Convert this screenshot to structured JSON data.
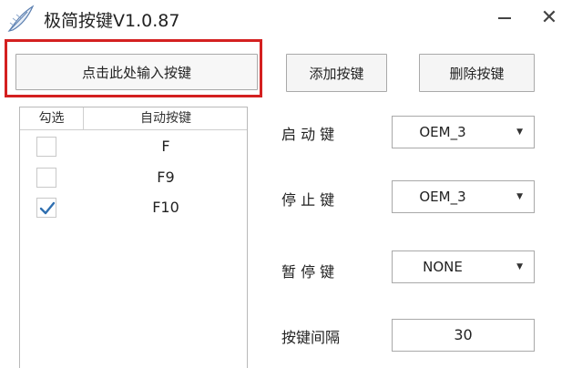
{
  "window": {
    "title": "极简按键V1.0.87",
    "minimize_icon": "minimize-icon",
    "close_glyph": "✕"
  },
  "toolbar": {
    "input_key_label": "点击此处输入按键",
    "add_label": "添加按键",
    "delete_label": "删除按键"
  },
  "key_list": {
    "columns": [
      "勾选",
      "自动按键"
    ],
    "rows": [
      {
        "key": "F",
        "checked": false
      },
      {
        "key": "F9",
        "checked": false
      },
      {
        "key": "F10",
        "checked": true
      }
    ]
  },
  "settings": {
    "start_key": {
      "label": "启 动 键",
      "value": "OEM_3"
    },
    "stop_key": {
      "label": "停 止 键",
      "value": "OEM_3"
    },
    "pause_key": {
      "label": "暂 停 键",
      "value": "NONE"
    },
    "interval": {
      "label": "按键间隔",
      "value": "30"
    }
  },
  "colors": {
    "highlight": "#d42020",
    "check": "#2f6fb0"
  }
}
